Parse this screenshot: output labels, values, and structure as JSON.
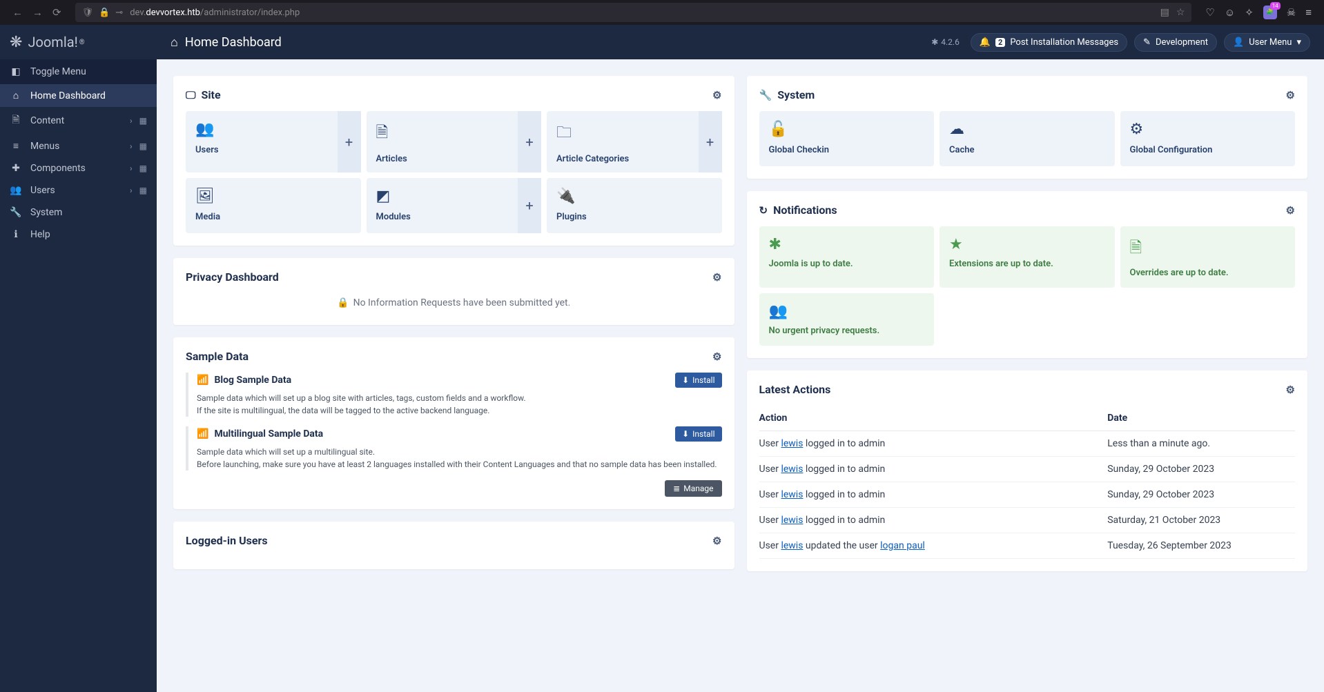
{
  "browser": {
    "url_prefix": "dev.",
    "url_host": "devvortex.htb",
    "url_path": "/administrator/index.php"
  },
  "sidebar": {
    "brand": "Joomla!",
    "toggle": "Toggle Menu",
    "items": [
      {
        "label": "Home Dashboard",
        "icon": "home",
        "active": true
      },
      {
        "label": "Content",
        "icon": "file",
        "hasChildren": true,
        "hasGrid": true
      },
      {
        "label": "Menus",
        "icon": "list",
        "hasChildren": true,
        "hasGrid": true
      },
      {
        "label": "Components",
        "icon": "puzzle",
        "hasChildren": true,
        "hasGrid": true
      },
      {
        "label": "Users",
        "icon": "users",
        "hasChildren": true,
        "hasGrid": true
      },
      {
        "label": "System",
        "icon": "wrench"
      },
      {
        "label": "Help",
        "icon": "info"
      }
    ]
  },
  "header": {
    "title": "Home Dashboard",
    "version": "4.2.6",
    "notifications_count": "2",
    "post_install": "Post Installation Messages",
    "development": "Development",
    "user_menu": "User Menu"
  },
  "site_panel": {
    "title": "Site",
    "tiles": [
      {
        "label": "Users",
        "plus": true
      },
      {
        "label": "Articles",
        "plus": true
      },
      {
        "label": "Article Categories",
        "plus": true
      },
      {
        "label": "Media",
        "plus": false
      },
      {
        "label": "Modules",
        "plus": true
      },
      {
        "label": "Plugins",
        "plus": false
      }
    ]
  },
  "privacy_panel": {
    "title": "Privacy Dashboard",
    "message": "No Information Requests have been submitted yet."
  },
  "sample_panel": {
    "title": "Sample Data",
    "install_label": "Install",
    "manage_label": "Manage",
    "items": [
      {
        "title": "Blog Sample Data",
        "desc1": "Sample data which will set up a blog site with articles, tags, custom fields and a workflow.",
        "desc2": "If the site is multilingual, the data will be tagged to the active backend language."
      },
      {
        "title": "Multilingual Sample Data",
        "desc1": "Sample data which will set up a multilingual site.",
        "desc2": "Before launching, make sure you have at least 2 languages installed with their Content Languages and that no sample data has been installed."
      }
    ]
  },
  "loggedin_panel": {
    "title": "Logged-in Users"
  },
  "system_panel": {
    "title": "System",
    "tiles": [
      {
        "label": "Global Checkin"
      },
      {
        "label": "Cache"
      },
      {
        "label": "Global Configuration"
      }
    ]
  },
  "notifications_panel": {
    "title": "Notifications",
    "tiles": [
      {
        "label": "Joomla is up to date."
      },
      {
        "label": "Extensions are up to date."
      },
      {
        "label": "Overrides are up to date."
      },
      {
        "label": "No urgent privacy requests."
      }
    ]
  },
  "actions_panel": {
    "title": "Latest Actions",
    "col_action": "Action",
    "col_date": "Date",
    "rows": [
      {
        "prefix": "User ",
        "user": "lewis",
        "suffix": " logged in to admin",
        "extra_user": "",
        "date": "Less than a minute ago."
      },
      {
        "prefix": "User ",
        "user": "lewis",
        "suffix": " logged in to admin",
        "extra_user": "",
        "date": "Sunday, 29 October 2023"
      },
      {
        "prefix": "User ",
        "user": "lewis",
        "suffix": " logged in to admin",
        "extra_user": "",
        "date": "Sunday, 29 October 2023"
      },
      {
        "prefix": "User ",
        "user": "lewis",
        "suffix": " logged in to admin",
        "extra_user": "",
        "date": "Saturday, 21 October 2023"
      },
      {
        "prefix": "User ",
        "user": "lewis",
        "suffix": " updated the user ",
        "extra_user": "logan paul",
        "date": "Tuesday, 26 September 2023"
      }
    ]
  }
}
